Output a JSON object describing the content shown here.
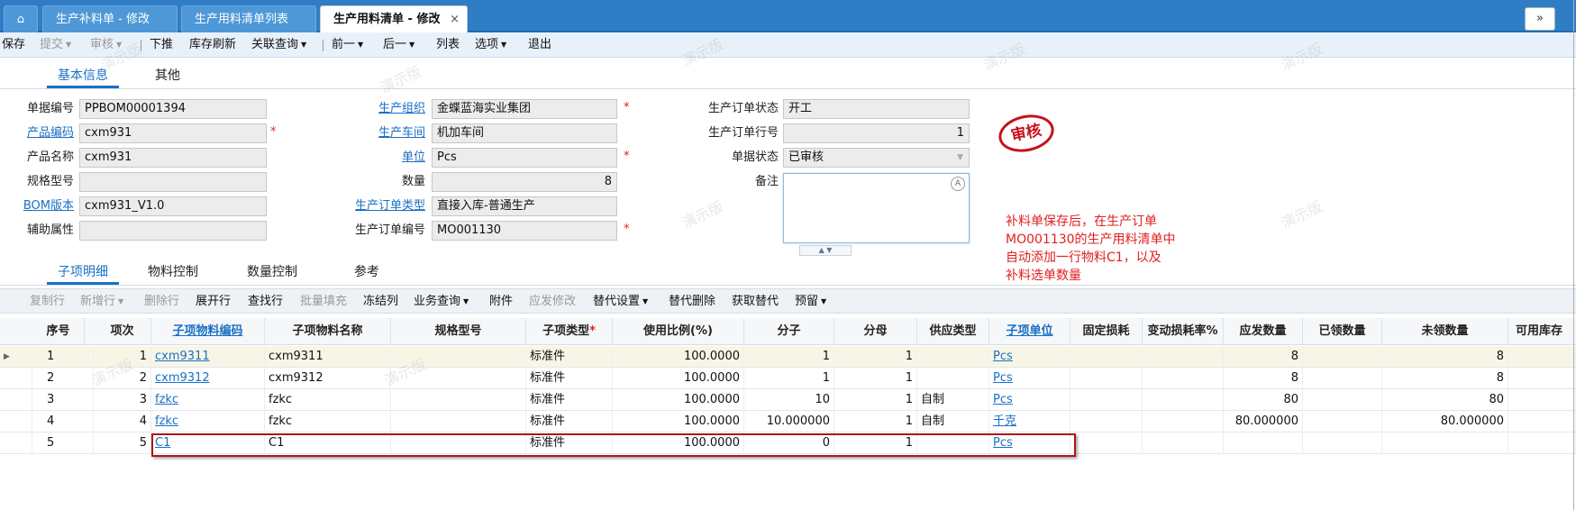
{
  "tabs": {
    "home": "⌂",
    "items": [
      {
        "label": "生产补料单 - 修改"
      },
      {
        "label": "生产用料清单列表"
      },
      {
        "label": "生产用料清单 - 修改",
        "close": "×"
      }
    ],
    "collapse": "»"
  },
  "toolbar": {
    "save": "保存",
    "submit": "提交",
    "audit": "审核",
    "push_down": "下推",
    "stock_refresh": "库存刷新",
    "related_query": "关联查询",
    "prev": "前一",
    "next": "后一",
    "list": "列表",
    "options": "选项",
    "exit": "退出"
  },
  "section_tabs": {
    "basic": "基本信息",
    "other": "其他"
  },
  "form": {
    "bill_no": {
      "label": "单据编号",
      "value": "PPBOM00001394"
    },
    "product_code": {
      "label": "产品编码",
      "value": "cxm931"
    },
    "product_name": {
      "label": "产品名称",
      "value": "cxm931"
    },
    "spec": {
      "label": "规格型号",
      "value": ""
    },
    "bom_version": {
      "label": "BOM版本",
      "value": "cxm931_V1.0"
    },
    "aux_attr": {
      "label": "辅助属性",
      "value": ""
    },
    "prod_org": {
      "label": "生产组织",
      "value": "金蝶蓝海实业集团"
    },
    "workshop": {
      "label": "生产车间",
      "value": "机加车间"
    },
    "unit": {
      "label": "单位",
      "value": "Pcs"
    },
    "qty": {
      "label": "数量",
      "value": "8"
    },
    "order_type": {
      "label": "生产订单类型",
      "value": "直接入库-普通生产"
    },
    "order_no": {
      "label": "生产订单编号",
      "value": "MO001130"
    },
    "order_status": {
      "label": "生产订单状态",
      "value": "开工"
    },
    "order_line": {
      "label": "生产订单行号",
      "value": "1"
    },
    "doc_status": {
      "label": "单据状态",
      "value": "已审核"
    },
    "remark": {
      "label": "备注",
      "value": ""
    },
    "required_mark": "*"
  },
  "stamp": "审核",
  "annotation": [
    "补料单保存后，在生产订单",
    "MO001130的生产用料清单中",
    "自动添加一行物料C1，以及",
    "补料选单数量"
  ],
  "detail_tabs": {
    "children": "子项明细",
    "material_control": "物料控制",
    "qty_control": "数量控制",
    "reference": "参考"
  },
  "grid_toolbar": {
    "copy_row": "复制行",
    "add_row": "新增行",
    "delete_row": "删除行",
    "expand_row": "展开行",
    "find_row": "查找行",
    "batch_fill": "批量填充",
    "freeze_col": "冻结列",
    "biz_query": "业务查询",
    "attachment": "附件",
    "issue_modify": "应发修改",
    "substitute_settings": "替代设置",
    "substitute_delete": "替代删除",
    "fetch_substitute": "获取替代",
    "reserve": "预留"
  },
  "grid": {
    "headers": [
      "序号",
      "项次",
      "子项物料编码",
      "子项物料名称",
      "规格型号",
      "子项类型",
      "使用比例(%)",
      "分子",
      "分母",
      "供应类型",
      "子项单位",
      "固定损耗",
      "变动损耗率%",
      "应发数量",
      "已领数量",
      "未领数量",
      "可用库存"
    ],
    "rows": [
      {
        "seq": "1",
        "item": "1",
        "code": "cxm9311",
        "name": "cxm9311",
        "spec": "",
        "type": "标准件",
        "ratio": "100.0000",
        "num": "1",
        "den": "1",
        "supply": "",
        "unit": "Pcs",
        "fixed": "",
        "var": "",
        "issue": "8",
        "picked": "",
        "unpicked": "8",
        "avail": ""
      },
      {
        "seq": "2",
        "item": "2",
        "code": "cxm9312",
        "name": "cxm9312",
        "spec": "",
        "type": "标准件",
        "ratio": "100.0000",
        "num": "1",
        "den": "1",
        "supply": "",
        "unit": "Pcs",
        "fixed": "",
        "var": "",
        "issue": "8",
        "picked": "",
        "unpicked": "8",
        "avail": ""
      },
      {
        "seq": "3",
        "item": "3",
        "code": "fzkc",
        "name": "fzkc",
        "spec": "",
        "type": "标准件",
        "ratio": "100.0000",
        "num": "10",
        "den": "1",
        "supply": "自制",
        "unit": "Pcs",
        "fixed": "",
        "var": "",
        "issue": "80",
        "picked": "",
        "unpicked": "80",
        "avail": ""
      },
      {
        "seq": "4",
        "item": "4",
        "code": "fzkc",
        "name": "fzkc",
        "spec": "",
        "type": "标准件",
        "ratio": "100.0000",
        "num": "10.000000",
        "den": "1",
        "supply": "自制",
        "unit": "千克",
        "fixed": "",
        "var": "",
        "issue": "80.000000",
        "picked": "",
        "unpicked": "80.000000",
        "avail": ""
      },
      {
        "seq": "5",
        "item": "5",
        "code": "C1",
        "name": "C1",
        "spec": "",
        "type": "标准件",
        "ratio": "100.0000",
        "num": "0",
        "den": "1",
        "supply": "",
        "unit": "Pcs",
        "fixed": "",
        "var": "",
        "issue": "",
        "picked": "",
        "unpicked": "",
        "avail": ""
      }
    ]
  },
  "watermark": "演示版",
  "colors": {
    "accent": "#2f7dc5",
    "link": "#1a6fc4",
    "required": "#e02020",
    "stamp": "#c8101a"
  }
}
